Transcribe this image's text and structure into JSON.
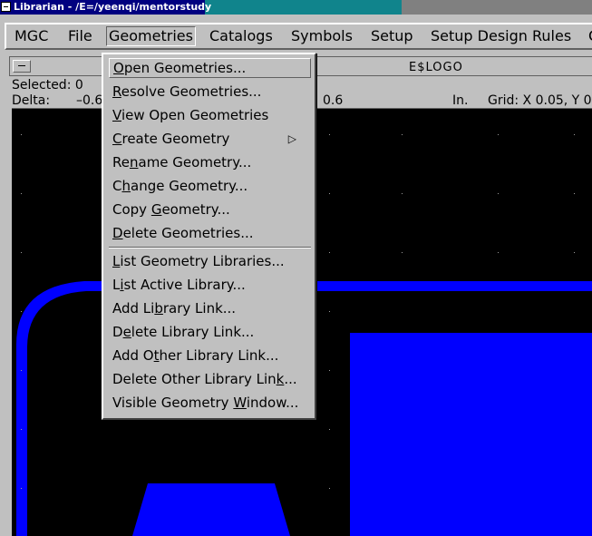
{
  "titlebar": {
    "title": "Librarian - /E=/yeenqi/mentorstudy"
  },
  "menubar": {
    "items": [
      "MGC",
      "File",
      "Geometries",
      "Catalogs",
      "Symbols",
      "Setup",
      "Setup Design Rules",
      "C"
    ]
  },
  "window": {
    "title": "E$LOGO",
    "status": {
      "selected": "Selected: 0",
      "delta_label": "Delta:",
      "delta_value": "–0.6",
      "delta_value2": "0.6",
      "units": "In.",
      "grid": "Grid: X 0.05, Y 0"
    }
  },
  "dropdown": {
    "items": [
      {
        "pre": "",
        "u": "O",
        "post": "pen Geometries...",
        "selected": true
      },
      {
        "pre": "",
        "u": "R",
        "post": "esolve Geometries..."
      },
      {
        "pre": "",
        "u": "V",
        "post": "iew Open Geometries"
      },
      {
        "pre": "",
        "u": "C",
        "post": "reate Geometry",
        "submenu": true
      },
      {
        "pre": "Re",
        "u": "n",
        "post": "ame Geometry..."
      },
      {
        "pre": "C",
        "u": "h",
        "post": "ange Geometry..."
      },
      {
        "pre": "Copy ",
        "u": "G",
        "post": "eometry..."
      },
      {
        "pre": "",
        "u": "D",
        "post": "elete Geometries..."
      },
      {
        "pre": "",
        "u": "L",
        "post": "ist Geometry Libraries..."
      },
      {
        "pre": "L",
        "u": "i",
        "post": "st Active Library..."
      },
      {
        "pre": "Add Li",
        "u": "b",
        "post": "rary Link..."
      },
      {
        "pre": "D",
        "u": "e",
        "post": "lete Library Link..."
      },
      {
        "pre": "Add O",
        "u": "t",
        "post": "her Library Link..."
      },
      {
        "pre": "Delete Other Library Lin",
        "u": "k",
        "post": "..."
      },
      {
        "pre": "Visible Geometry ",
        "u": "W",
        "post": "indow..."
      }
    ]
  },
  "colors": {
    "shape": "#0000ff",
    "canvas": "#000000",
    "titlebar": "#000080"
  }
}
